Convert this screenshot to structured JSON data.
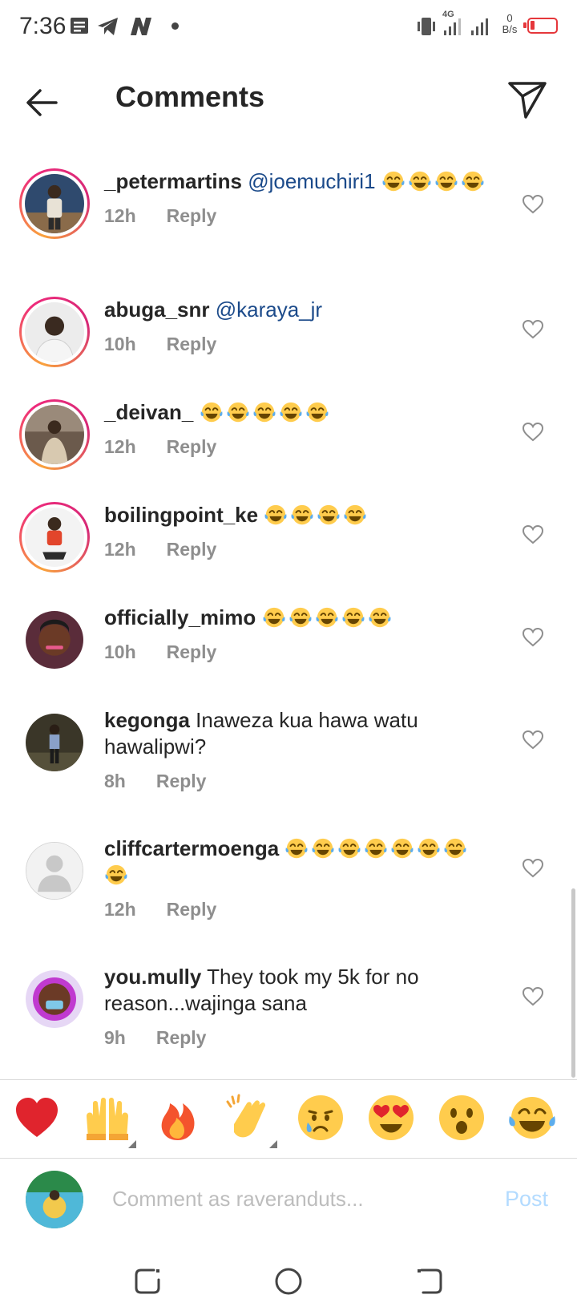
{
  "status_bar": {
    "time": "7:36",
    "net_speed_value": "0",
    "net_speed_unit": "B/s",
    "network_type": "4G",
    "battery_level": 0.15,
    "battery_color": "#e5373b",
    "icons": [
      "message-icon",
      "telegram-icon",
      "n-app-icon",
      "notification-dot",
      "vibrate-icon",
      "signal-4g-icon",
      "signal-icon",
      "battery-icon"
    ]
  },
  "header": {
    "title": "Comments",
    "back_icon": "arrow-left-icon",
    "share_icon": "send-icon"
  },
  "comments": [
    {
      "username": "_petermartins",
      "mention": "@joemuchiri1",
      "text": "",
      "emoji_count": 4,
      "time": "12h",
      "reply_label": "Reply",
      "story_ring": true
    },
    {
      "username": "abuga_snr",
      "mention": "@karaya_jr",
      "text": "",
      "emoji_count": 0,
      "time": "10h",
      "reply_label": "Reply",
      "story_ring": true
    },
    {
      "username": "_deivan_",
      "mention": "",
      "text": "",
      "emoji_count": 5,
      "time": "12h",
      "reply_label": "Reply",
      "story_ring": true
    },
    {
      "username": "boilingpoint_ke",
      "mention": "",
      "text": "",
      "emoji_count": 4,
      "time": "12h",
      "reply_label": "Reply",
      "story_ring": true
    },
    {
      "username": "officially_mimo",
      "mention": "",
      "text": "",
      "emoji_count": 5,
      "time": "10h",
      "reply_label": "Reply",
      "story_ring": false
    },
    {
      "username": "kegonga",
      "mention": "",
      "text": "Inaweza kua hawa watu hawalipwi?",
      "emoji_count": 0,
      "time": "8h",
      "reply_label": "Reply",
      "story_ring": false
    },
    {
      "username": "cliffcartermoenga",
      "mention": "",
      "text": "",
      "emoji_count": 8,
      "time": "12h",
      "reply_label": "Reply",
      "story_ring": false
    },
    {
      "username": "you.mully",
      "mention": "",
      "text": "They took my 5k for no reason...wajinga sana",
      "emoji_count": 0,
      "time": "9h",
      "reply_label": "Reply",
      "story_ring": false
    }
  ],
  "comment_emoji": "face-with-tears-of-joy-icon",
  "emoji_bar": [
    "red-heart-icon",
    "raising-hands-icon",
    "fire-icon",
    "clapping-hands-icon",
    "crying-face-icon",
    "heart-eyes-icon",
    "astonished-face-icon",
    "tears-of-joy-icon"
  ],
  "compose": {
    "placeholder": "Comment as raveranduts...",
    "post_label": "Post",
    "post_color": "#b3dbff"
  },
  "nav_bar": [
    "recent-apps-icon",
    "home-icon",
    "back-icon"
  ]
}
